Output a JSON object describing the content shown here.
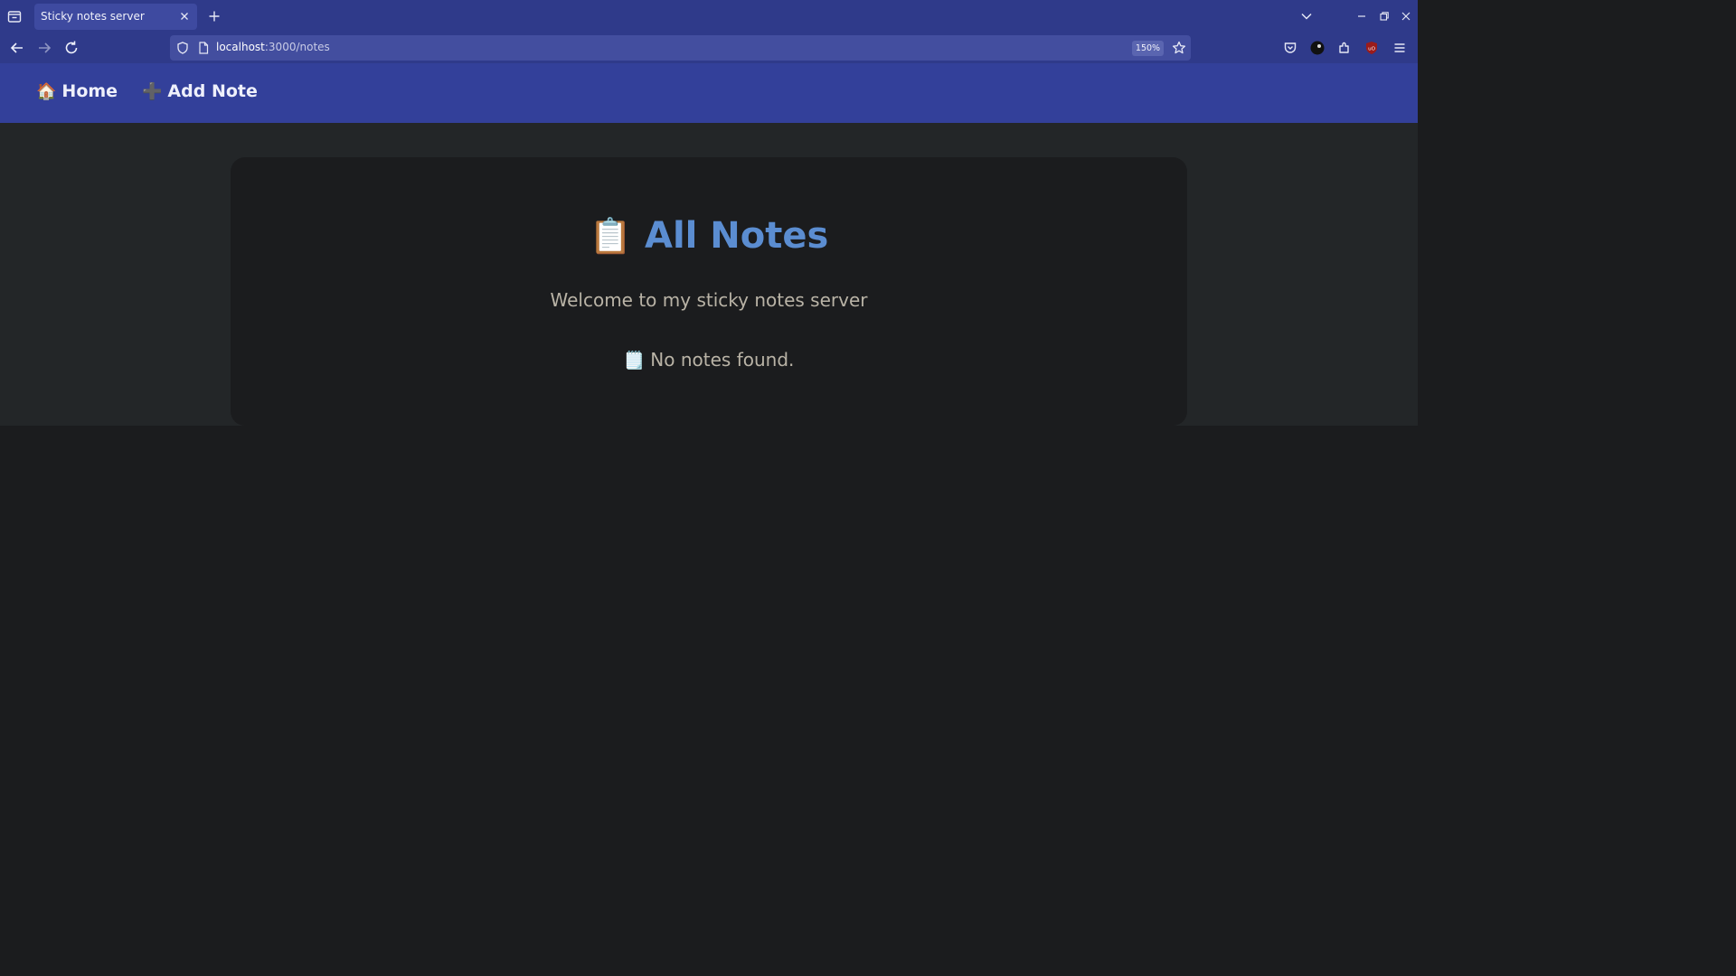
{
  "browser": {
    "tab": {
      "title": "Sticky notes server"
    },
    "url": {
      "host": "localhost",
      "path": ":3000/notes"
    },
    "zoom": "150%",
    "icons": [
      "tab-list-icon",
      "close-icon",
      "plus-icon",
      "chevron-down-icon",
      "minimize-icon",
      "restore-icon",
      "close-window-icon",
      "back-arrow-icon",
      "forward-arrow-icon",
      "reload-icon",
      "shield-icon",
      "page-icon",
      "star-icon",
      "pocket-icon",
      "account-icon",
      "extensions-icon",
      "ublock-icon",
      "menu-icon"
    ]
  },
  "app": {
    "nav": [
      {
        "icon": "🏠",
        "label": "Home"
      },
      {
        "icon": "➕",
        "label": "Add Note"
      }
    ],
    "title_icon": "📋",
    "title": "All Notes",
    "subtitle": "Welcome to my sticky notes server",
    "empty_icon": "🗒️",
    "empty_text": "No notes found."
  },
  "colors": {
    "chrome": "#2f3a8a",
    "appnav": "#33409a",
    "title": "#5b8dd1",
    "text": "#b9b3a6",
    "card": "#1b1c1e",
    "band": "#232628"
  }
}
